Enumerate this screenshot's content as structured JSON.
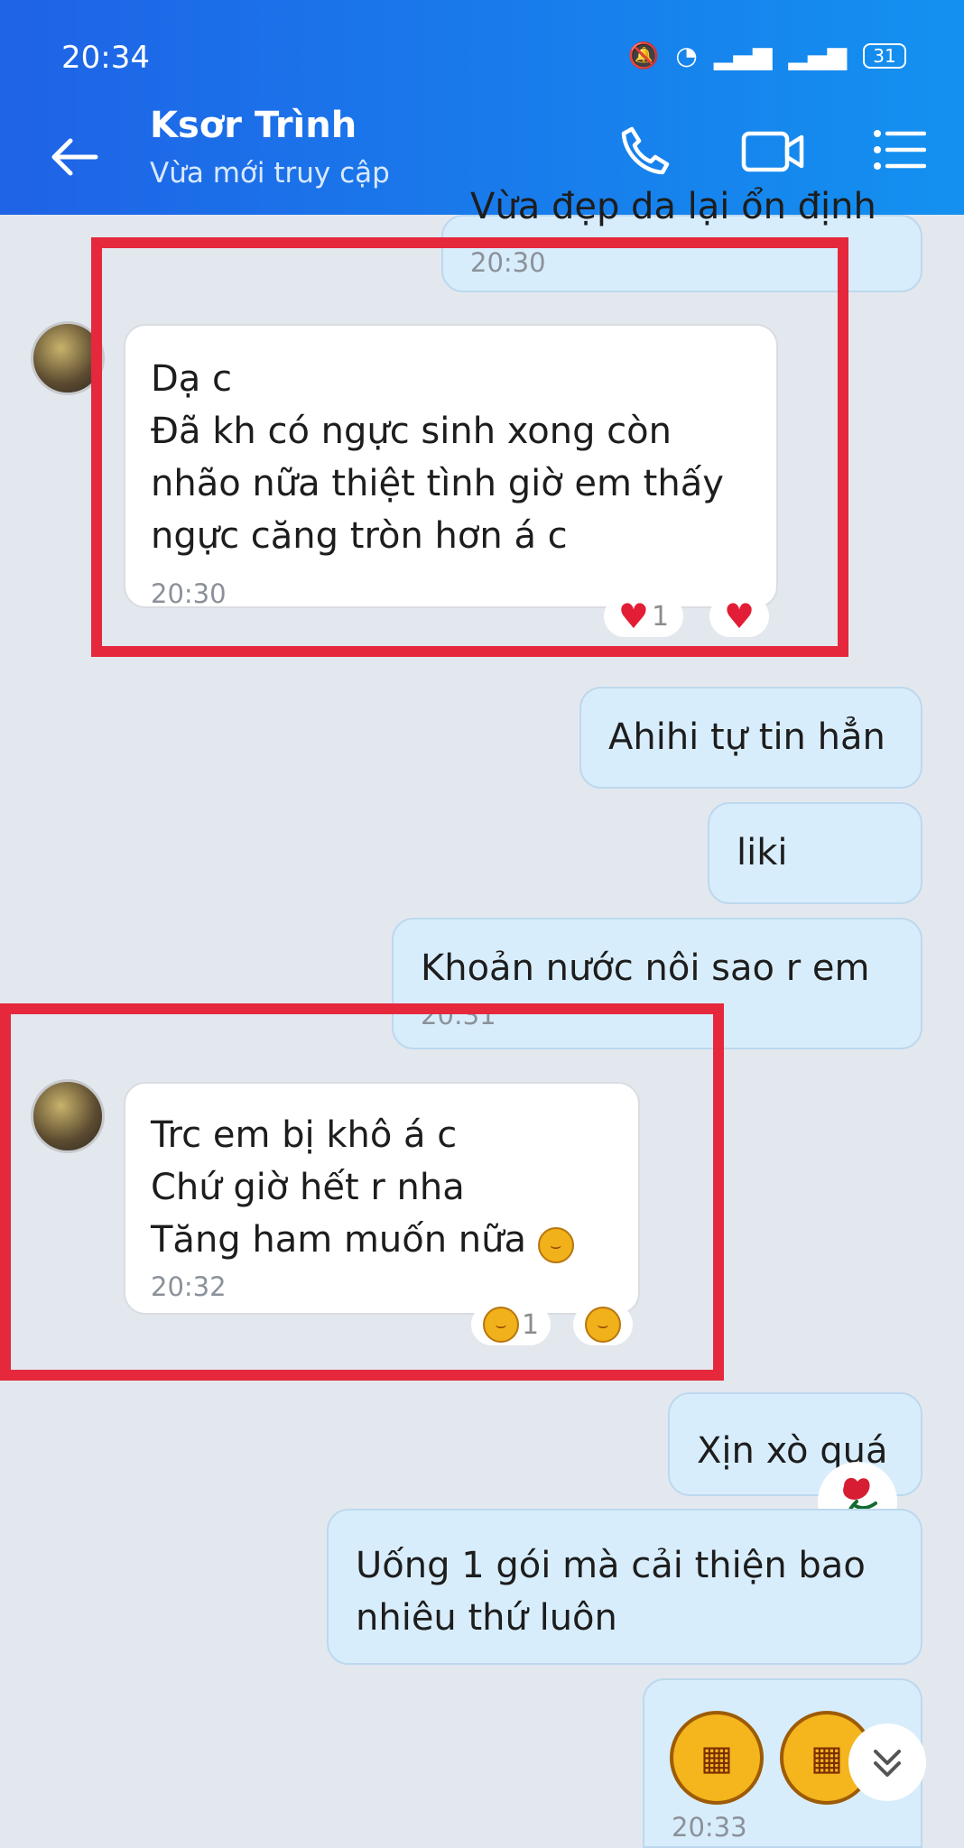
{
  "status_bar": {
    "time": "20:34",
    "battery": "31"
  },
  "header": {
    "contact_name": "Ksơr Trình",
    "contact_status": "Vừa mới truy cập"
  },
  "messages": {
    "top_partial": {
      "text": "Vừa đẹp da lại ổn định",
      "time": "20:30"
    },
    "first_received": {
      "line1": "Dạ c",
      "line2": "Đã kh có ngực sinh xong còn",
      "line3": "nhão nữa thiệt tình giờ em thấy",
      "line4": "ngực căng tròn hơn á c",
      "time": "20:30",
      "reaction_count": "1"
    },
    "sent_1": {
      "text": "Ahihi tự tin hẳn"
    },
    "sent_2": {
      "text": "liki"
    },
    "sent_3": {
      "text": "Khoản nước nôi sao r em",
      "time": "20:31"
    },
    "second_received": {
      "line1": " Trc em bị khô á c",
      "line2": "Chứ giờ hết r nha",
      "line3": "Tăng ham muốn nữa",
      "time": "20:32",
      "reaction_count": "1"
    },
    "sent_4": {
      "text": "Xịn xò quá"
    },
    "sent_5": {
      "line1": "Uống 1 gói mà cải thiện bao",
      "line2": "nhiêu thứ luôn"
    },
    "sent_6": {
      "time": "20:33"
    }
  },
  "colors": {
    "header_start": "#1f63e6",
    "header_end": "#1391f0",
    "chat_background": "#e3e8ef",
    "sent_bubble": "#d8edfb",
    "received_bubble": "#ffffff",
    "highlight_red": "#e5283c",
    "heart_red": "#e31d35"
  },
  "icons": {
    "back": "back-arrow-icon",
    "call": "phone-icon",
    "video": "video-camera-icon",
    "menu": "menu-icon",
    "heart": "heart-icon",
    "emoji": "laughing-emoji-icon",
    "rose": "rose-icon",
    "scroll": "chevron-down-icon"
  }
}
